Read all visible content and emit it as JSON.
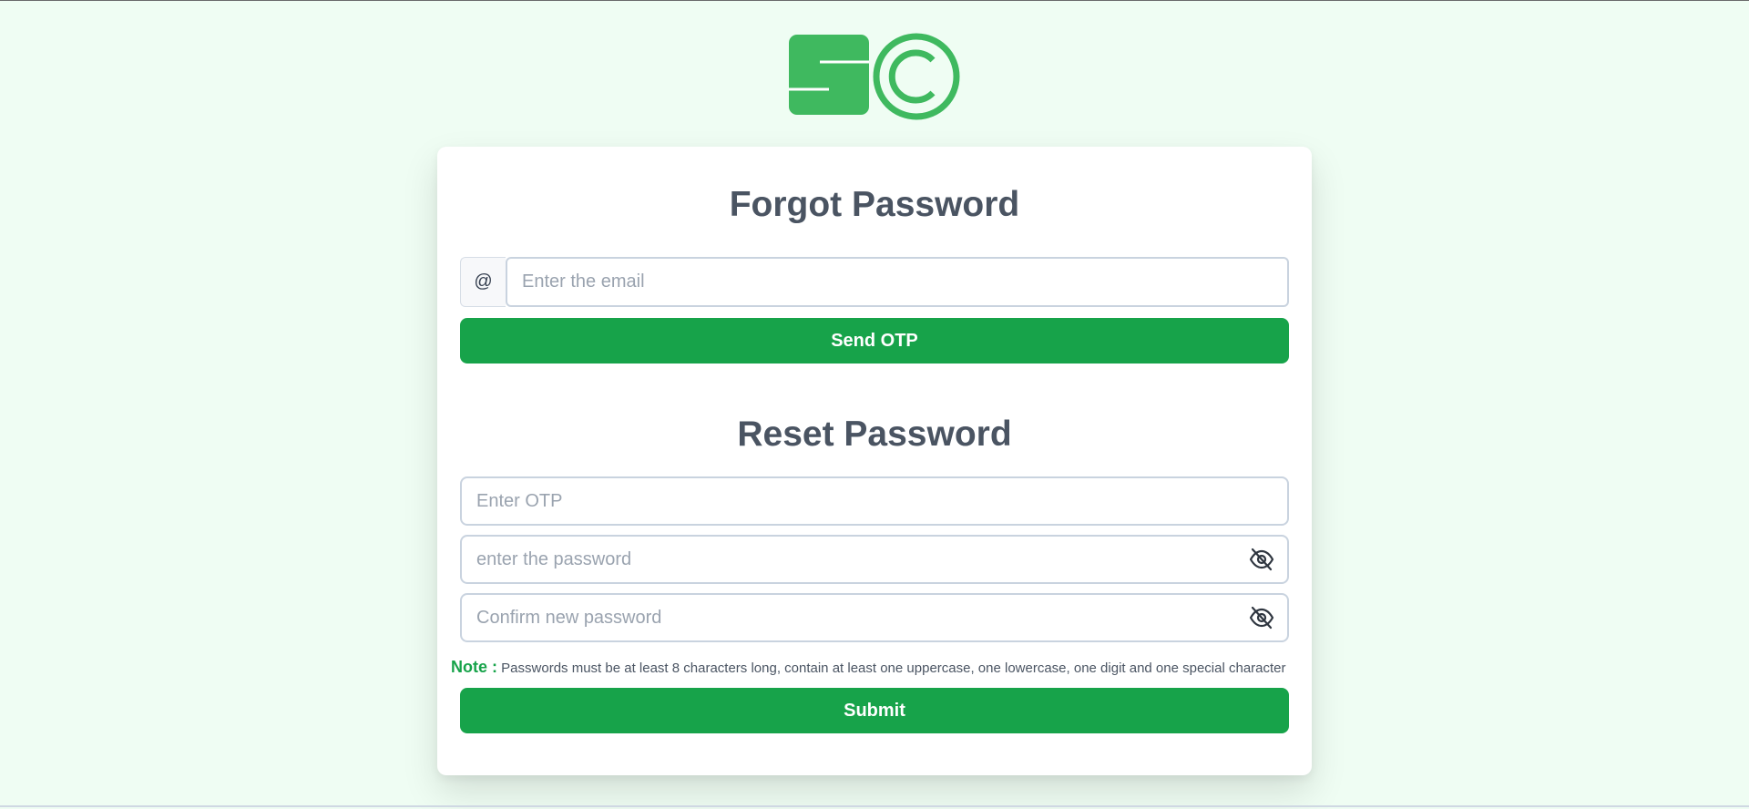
{
  "logo": {
    "primary_color": "#3fb95f"
  },
  "forgot": {
    "title": "Forgot Password",
    "email_addon": "@",
    "email_placeholder": "Enter the email",
    "email_value": "",
    "send_otp_label": "Send OTP"
  },
  "reset": {
    "title": "Reset Password",
    "otp_placeholder": "Enter OTP",
    "otp_value": "",
    "password_placeholder": "enter the password",
    "password_value": "",
    "confirm_placeholder": "Confirm new password",
    "confirm_value": "",
    "toggle_icon": "eye-off-icon",
    "note_label": "Note :",
    "note_text": "Passwords must be at least 8 characters long, contain at least one uppercase, one lowercase, one digit and one special character",
    "submit_label": "Submit"
  },
  "colors": {
    "accent": "#17a34a",
    "page_background": "#effdf3",
    "heading": "#4a5462"
  }
}
